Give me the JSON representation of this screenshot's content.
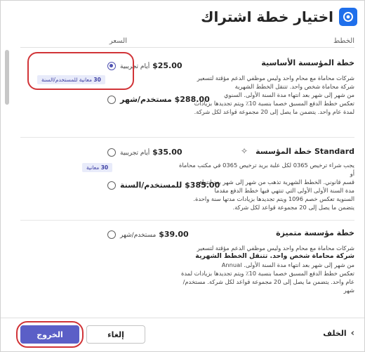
{
  "header": {
    "title": "اختيار خطة اشتراك"
  },
  "columns": {
    "plan": "الخطط",
    "price": "السعر"
  },
  "plans": [
    {
      "title": "خطة المؤسسة الأساسية",
      "desc": [
        "شركات محاماة مع محام واحد وليس موظفي الدعم مؤقتة لتسعير",
        "شركة محاماة شخص واحد. تتنقل الخطط الشهرية",
        "من شهر إلى شهر بعد انتهاء مدة السنة الأولى. السنوي",
        "تعكس خطط الدفع المسبق خصما بنسبة 10٪ ويتم تجديدها بزيادات",
        "لمدة عام واحد. يتضمن ما يصل إلى 20 مجموعة قواعد لكل شركة."
      ],
      "option1": {
        "price": "$25.00",
        "unit": "أيام تجريبية",
        "badge_num": "30",
        "badge_text": "معانية للمستخدم/السنة"
      },
      "option2": {
        "price": "$288.00",
        "unit": "مستخدم/شهر"
      }
    },
    {
      "title_en": "Standard",
      "title": "خطة المؤسسة",
      "desc": [
        "يجب شراء ترخيص 0365 لكل علبة بريد ترخيص 0365 في مكتب محاماة أو",
        "قسم قانوني. الخطط الشهرية تذهب من شهر إلى شهر بعد انتهاء",
        "مدة السنة الأولى الأولى التي تنتهي فيها خطط الدفع مقدما",
        "السنوية تعكس خصم 1096 ويتم تجديدها بزيادات مدتها سنة واحدة.",
        "يتضمن ما يصل إلى 20 مجموعة قواعد لكل شركة."
      ],
      "option1": {
        "price": "$35.00",
        "unit": "أيام تجريبية",
        "badge_num": "30",
        "badge_text": "معانية"
      },
      "option2": {
        "price": "$385.00",
        "unit": "للمستخدم/السنة"
      }
    },
    {
      "title": "خطة مؤسسة متميزة",
      "desc_lines": [
        {
          "text": "شركات محاماة مع محام واحد وليس موظفي الدعم مؤقتة لتسعير",
          "bold": false
        },
        {
          "text": "شركة محاماة شخص واحد. تتنقل الخطط الشهرية",
          "bold": true
        },
        {
          "text": "من شهر إلى شهر بعد انتهاء مدة السنة الأولى. Annual",
          "bold": false
        },
        {
          "text": "تعكس خطط الدفع المسبق خصما بنسبة 10٪ ويتم تجديدها بزيادات لمدة",
          "bold": false
        },
        {
          "text": "عام واحد. يتضمن ما يصل إلى 20 مجموعة قواعد لكل شركة. مستخدم/شهر",
          "bold": false
        }
      ],
      "option1": {
        "price": "$39.00",
        "unit": "مستخدم/شهر"
      }
    }
  ],
  "footer": {
    "back": "الخلف",
    "cancel": "إلغاء",
    "exit": "الخروج"
  },
  "colors": {
    "accent": "#5b5fc7",
    "highlight": "#d13438",
    "badge_bg": "#e8ebfa"
  }
}
